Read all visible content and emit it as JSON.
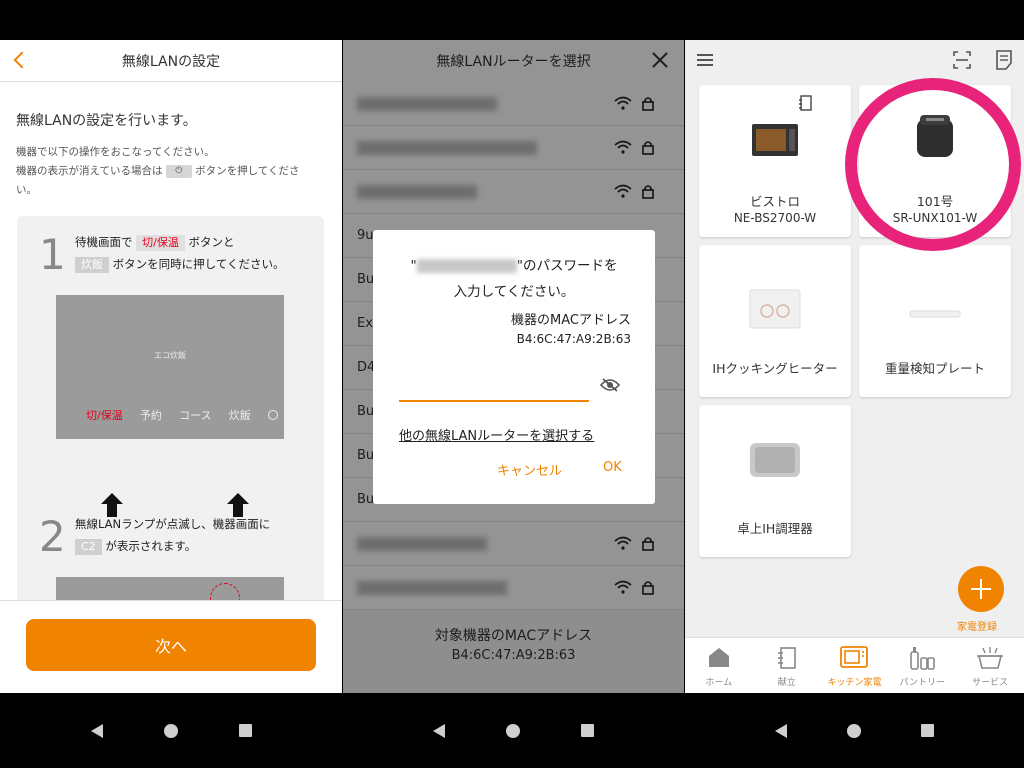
{
  "screen1": {
    "title": "無線LANの設定",
    "lead": "無線LANの設定を行います。",
    "desc_line1": "機器で以下の操作をおこなってください。",
    "desc_line2_a": "機器の表示が消えている場合は",
    "desc_line2_b": "ボタンを押してくださ",
    "desc_line3": "い。",
    "step1": {
      "number": "1",
      "text_a": "待機画面で",
      "tag1": "切/保温",
      "text_b": "ボタンと",
      "tag2": "炊飯",
      "text_c": "ボタンを同時に押してください。",
      "display_title": "エコ炊飯",
      "display_keys": [
        "切/保温",
        "予約",
        "コース",
        "炊飯"
      ]
    },
    "step2": {
      "number": "2",
      "text_a": "無線LANランプが点滅し、機器画面に",
      "tag": "C2",
      "text_b": "が表示されます。"
    },
    "next_label": "次へ"
  },
  "screen2": {
    "title": "無線LANルーターを選択",
    "visible_ssids": [
      "9u",
      "Bu",
      "Ex",
      "D4",
      "Bu",
      "Bu",
      "Bu"
    ],
    "dialog": {
      "line1_quote_open": "\"",
      "line1_suffix": "\"のパスワードを",
      "line2": "入力してください。",
      "mac_title": "機器のMACアドレス",
      "mac_value": "B4:6C:47:A9:2B:63",
      "password_value": "",
      "other_router_link": "他の無線LANルーターを選択する",
      "cancel_label": "キャンセル",
      "ok_label": "OK"
    },
    "mac_title": "対象機器のMACアドレス",
    "mac_value": "B4:6C:47:A9:2B:63"
  },
  "screen3": {
    "devices": [
      {
        "name": "ビストロ",
        "model": "NE-BS2700-W"
      },
      {
        "name": "101号",
        "model": "SR-UNX101-W"
      },
      {
        "name": "IHクッキングヒーター",
        "model": ""
      },
      {
        "name": "重量検知プレート",
        "model": ""
      },
      {
        "name": "卓上IH調理器",
        "model": ""
      }
    ],
    "add_label": "家電登録",
    "tabs": [
      {
        "label": "ホーム",
        "icon": "home-icon"
      },
      {
        "label": "献立",
        "icon": "menu-book-icon"
      },
      {
        "label": "キッチン家電",
        "icon": "microwave-icon"
      },
      {
        "label": "パントリー",
        "icon": "pantry-icon"
      },
      {
        "label": "サービス",
        "icon": "service-icon"
      }
    ],
    "active_tab": "キッチン家電"
  },
  "colors": {
    "accent": "#f08300",
    "highlight": "#e8247a",
    "tag_red": "#e5001c"
  }
}
